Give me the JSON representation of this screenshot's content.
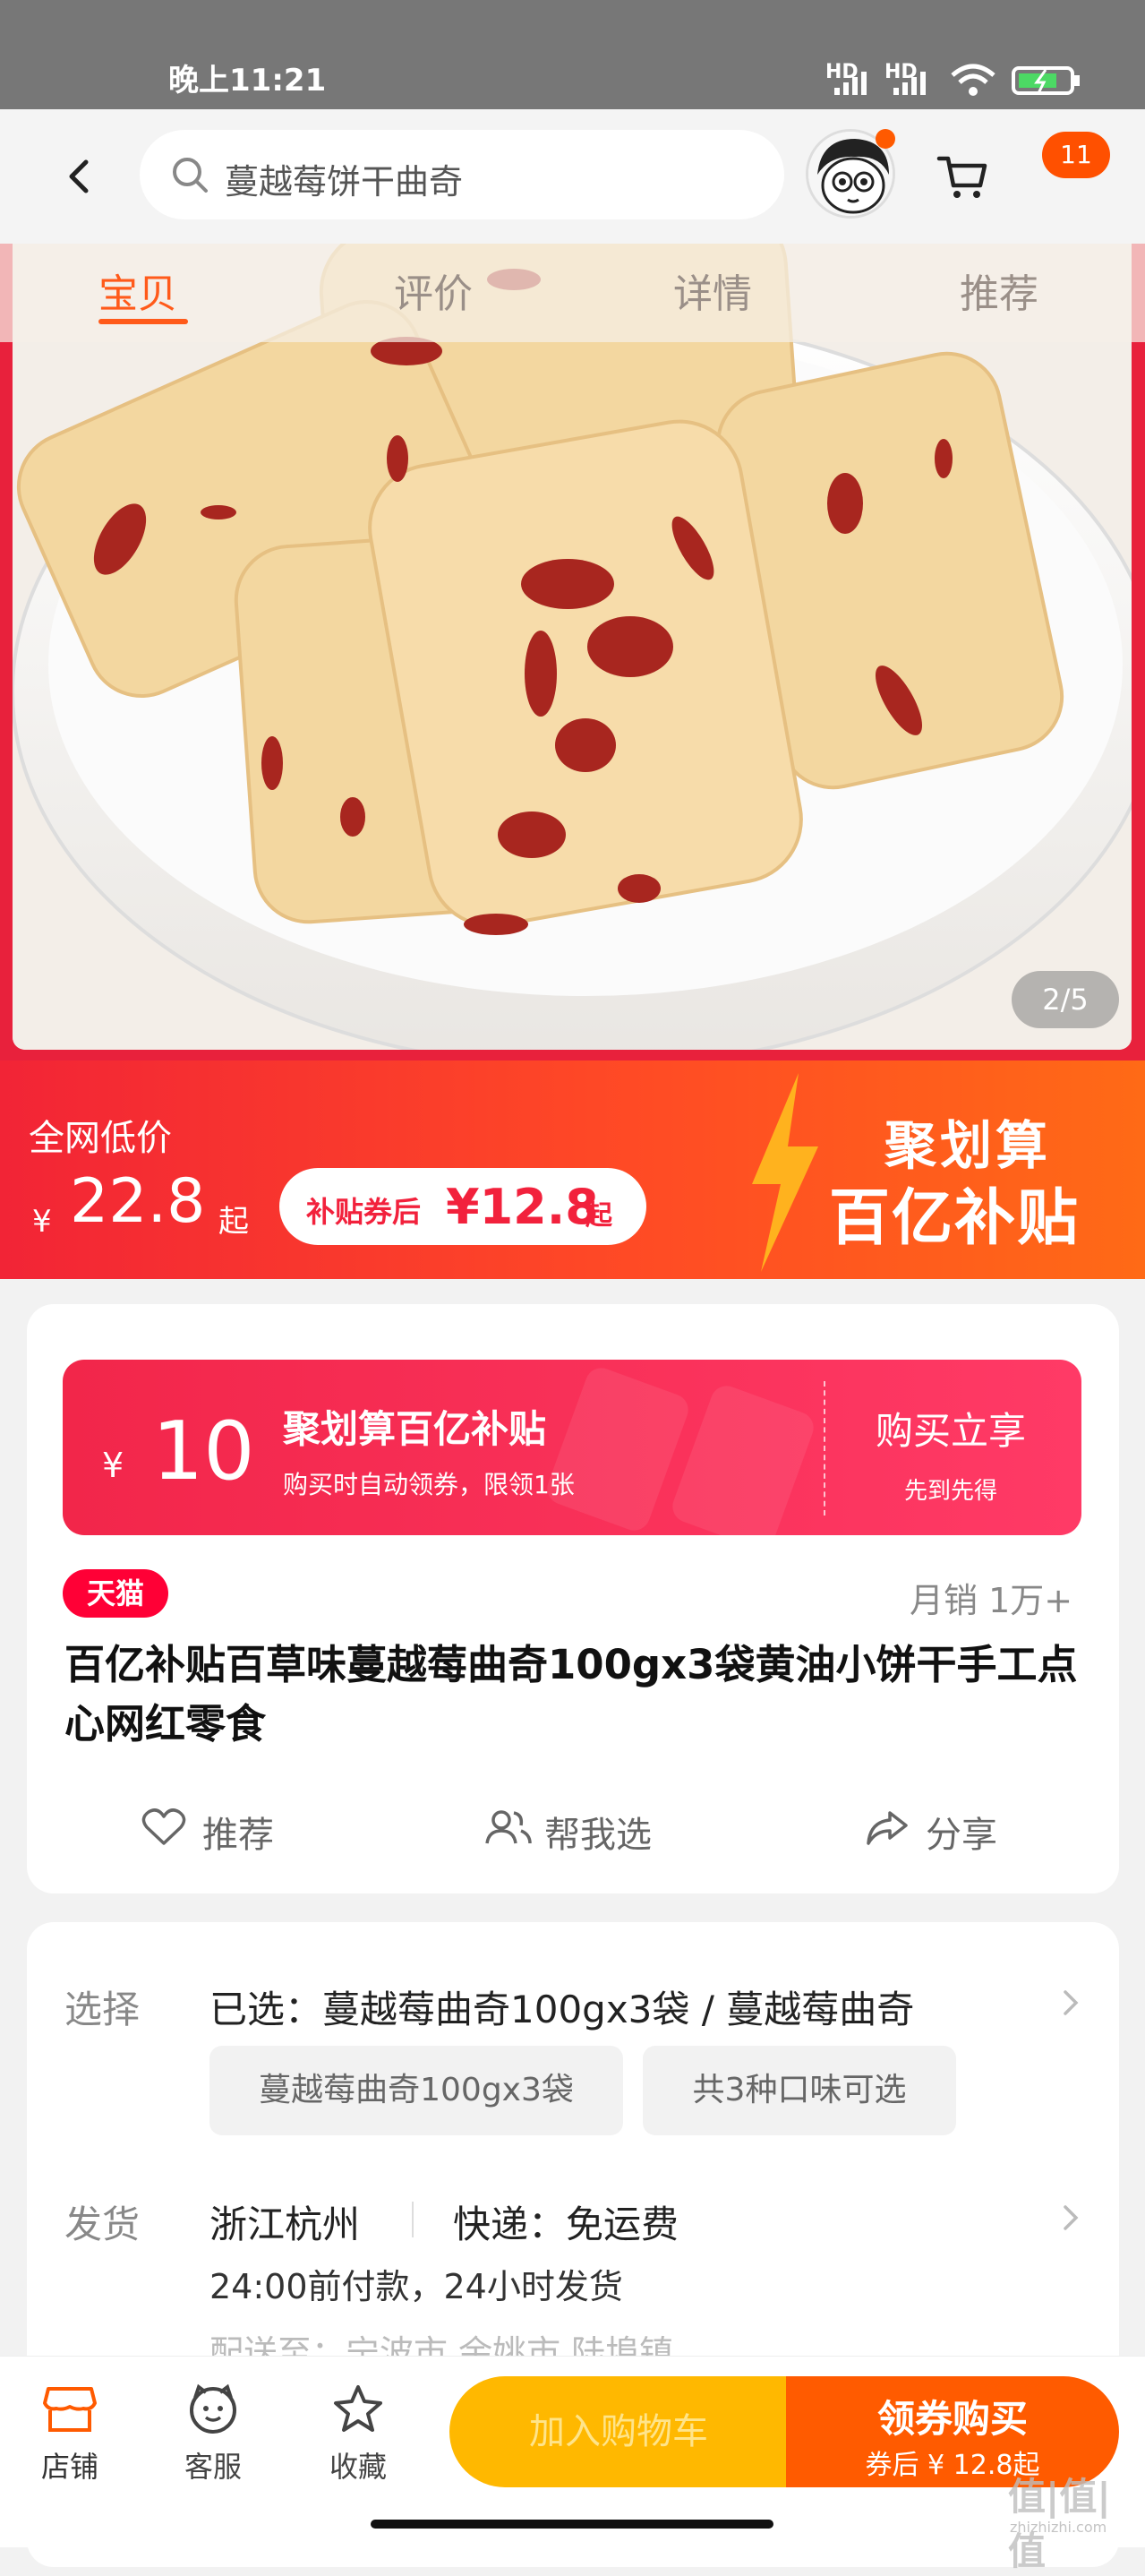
{
  "status_bar": {
    "time": "晚上11:21",
    "signal1": "HD",
    "signal2": "HD"
  },
  "nav": {
    "search_text": "蔓越莓饼干曲奇",
    "cart_badge": "11"
  },
  "product_tabs": [
    {
      "label": "宝贝",
      "active": true
    },
    {
      "label": "评价"
    },
    {
      "label": "详情"
    },
    {
      "label": "推荐"
    }
  ],
  "gallery": {
    "counter": "2/5"
  },
  "promo": {
    "label": "全网低价",
    "currency": "¥",
    "price": "22.8",
    "price_suffix": "起",
    "subsidy_prefix": "补贴券后",
    "subsidy_price": "¥12.8",
    "subsidy_suffix": "起",
    "brand_line1": "聚划算",
    "brand_line2": "百亿补贴"
  },
  "coupon": {
    "currency": "¥",
    "amount": "10",
    "title": "聚划算百亿补贴",
    "desc": "购买时自动领券，限领1张",
    "action": "购买立享",
    "action_sub": "先到先得"
  },
  "product": {
    "badge": "天猫",
    "monthly_sales": "月销 1万+",
    "title": "百亿补贴百草味蔓越莓曲奇100gx3袋黄油小饼干手工点心网红零食"
  },
  "actions": {
    "recommend": "推荐",
    "help_choose": "帮我选",
    "share": "分享"
  },
  "details": {
    "select_label": "选择",
    "select_value": "已选：蔓越莓曲奇100gx3袋 / 蔓越莓曲奇",
    "options": [
      "蔓越莓曲奇100gx3袋",
      "共3种口味可选"
    ],
    "ship_label": "发货",
    "ship_origin": "浙江杭州",
    "ship_method": "快递：免运费",
    "ship_time": "24:00前付款，24小时发货",
    "delivery_partial": "配送至：宁波市 余姚市 陆埠镇"
  },
  "bottom": {
    "store": "店铺",
    "service": "客服",
    "favorite": "收藏",
    "add_cart": "加入购物车",
    "buy": "领券购买",
    "buy_sub": "券后 ¥ 12.8起"
  },
  "watermark": {
    "main": "值|值|值",
    "site": "zhizhizhi.com"
  },
  "colors": {
    "accent": "#ff5a00",
    "subsidy_red": "#f2213c",
    "tmall_red": "#ff0036"
  }
}
